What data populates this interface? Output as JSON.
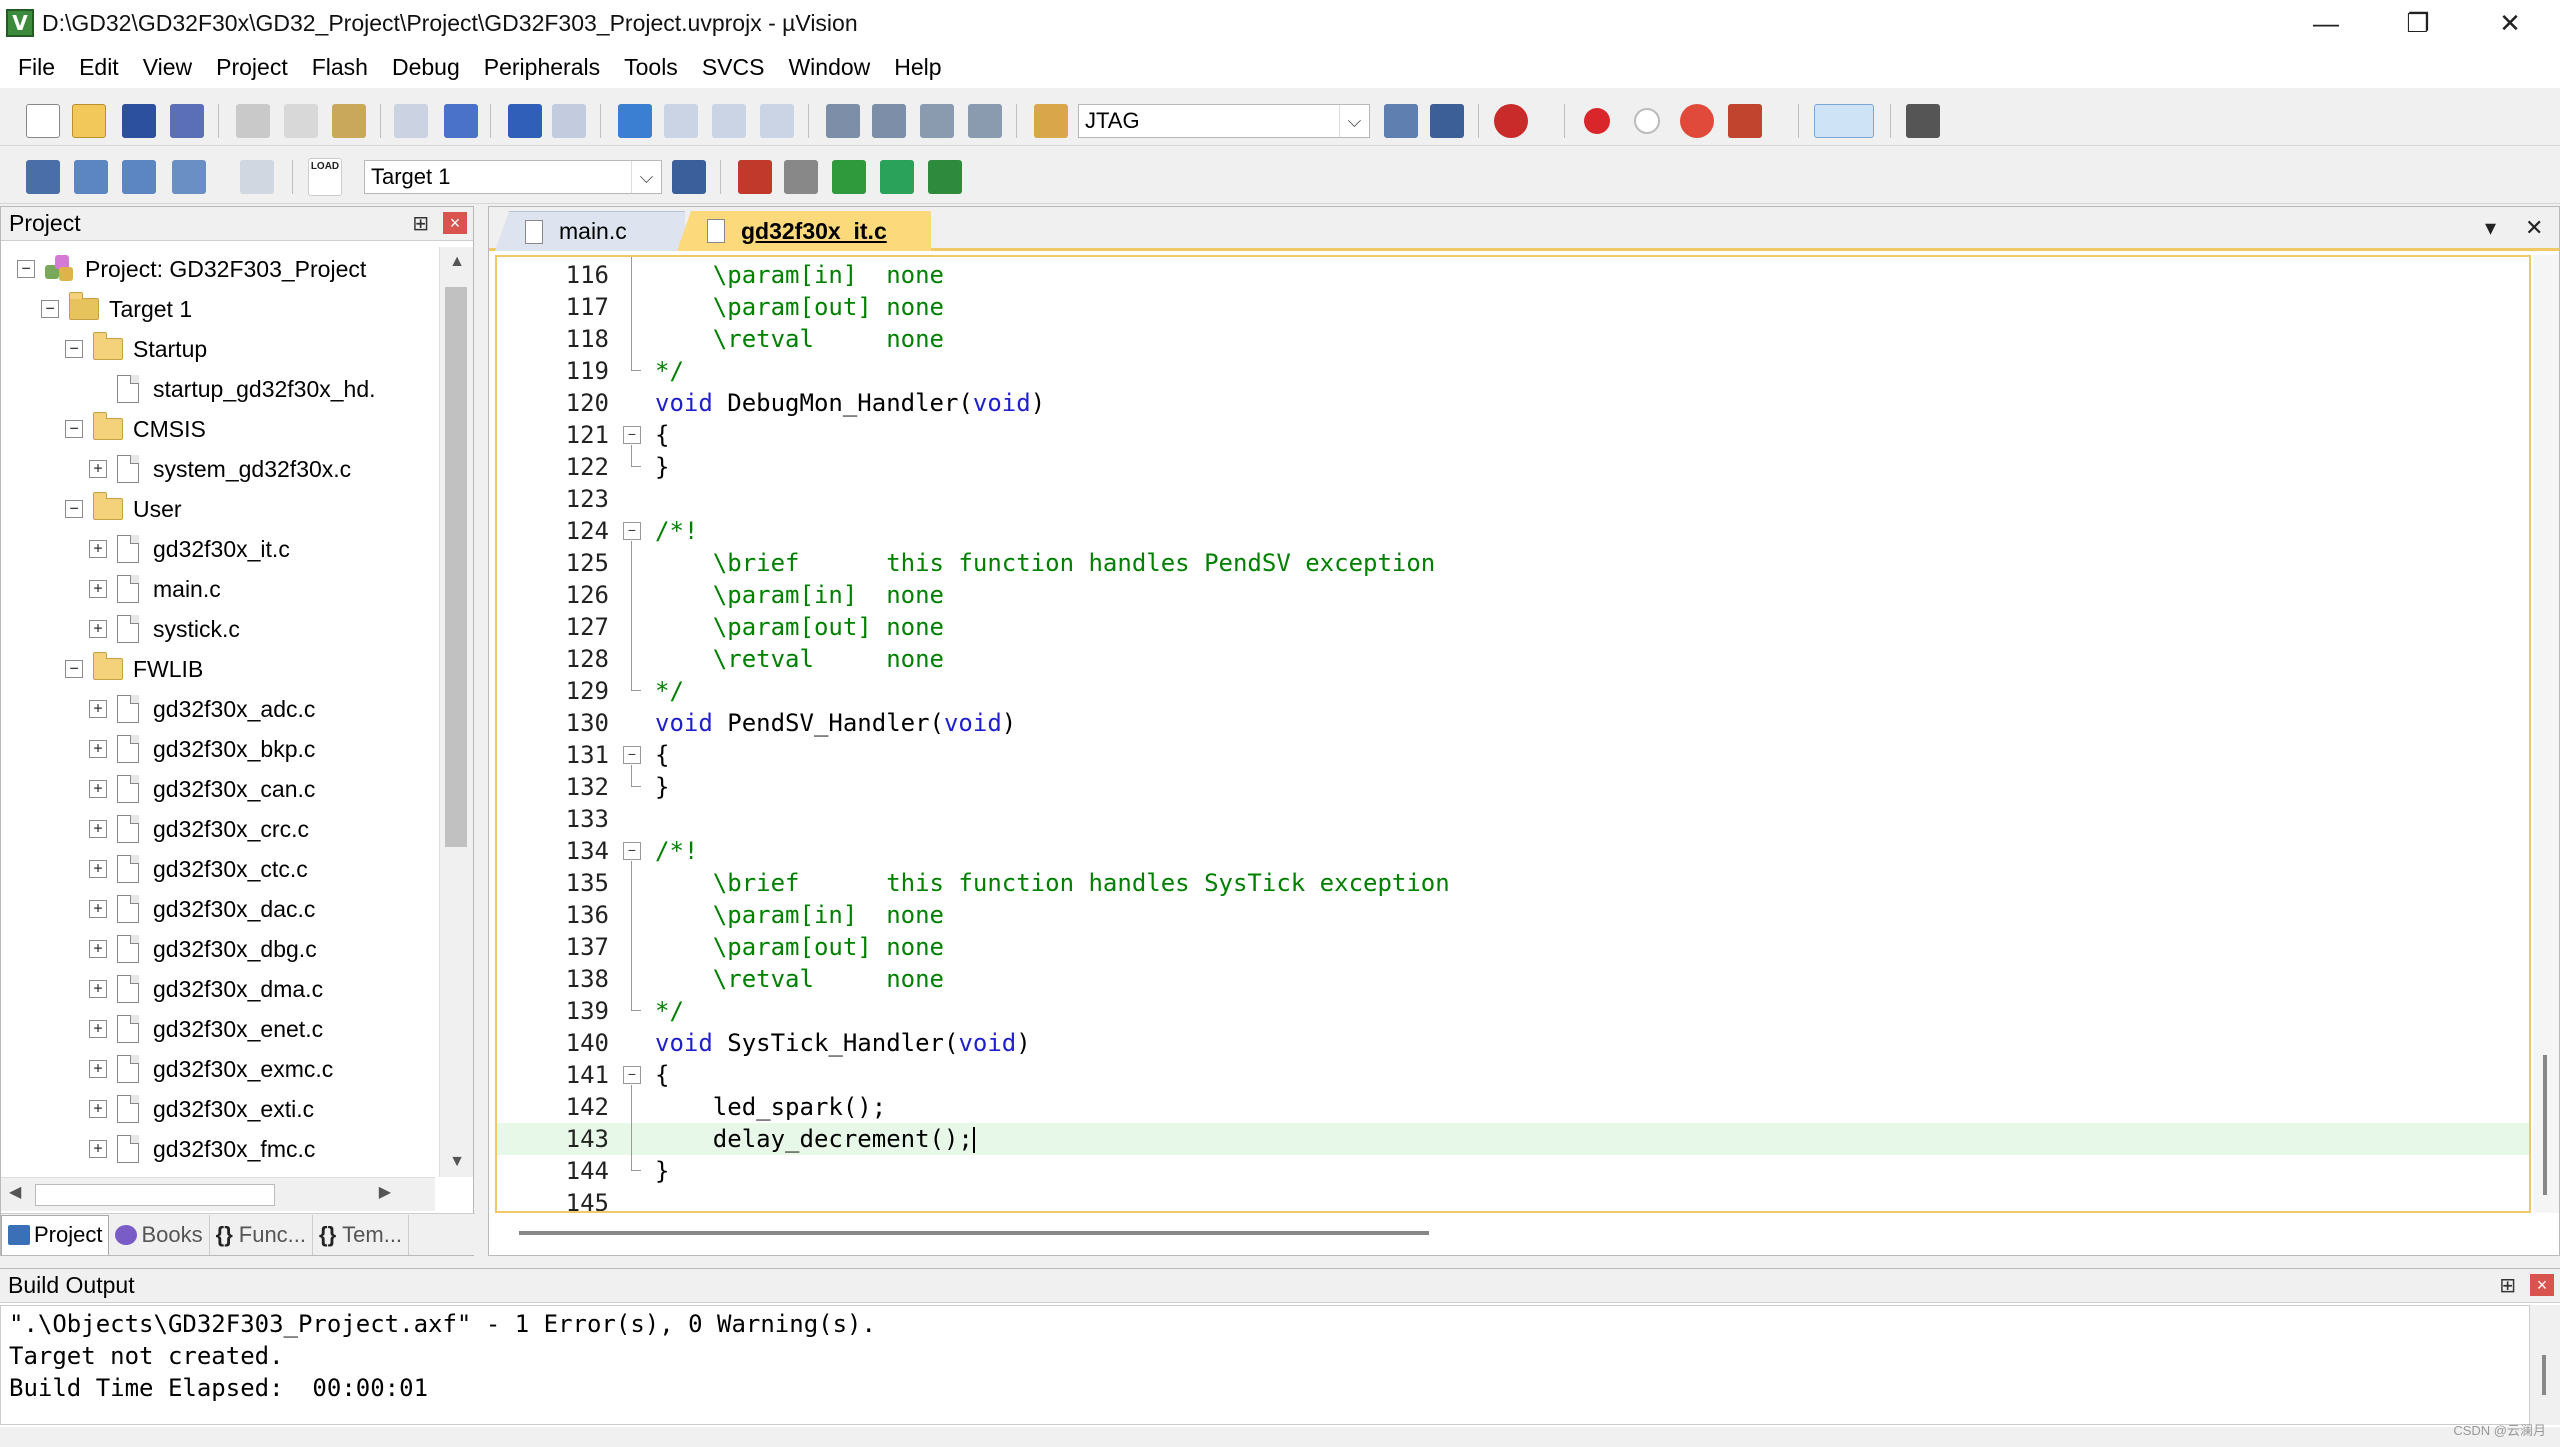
{
  "window": {
    "title": "D:\\GD32\\GD32F30x\\GD32_Project\\Project\\GD32F303_Project.uvprojx - µVision",
    "icon_letter": "V",
    "minimize": "—",
    "maximize": "❐",
    "close": "✕"
  },
  "menu": [
    "File",
    "Edit",
    "View",
    "Project",
    "Flash",
    "Debug",
    "Peripherals",
    "Tools",
    "SVCS",
    "Window",
    "Help"
  ],
  "toolbar": {
    "debug_adapter": "JTAG",
    "target": "Target 1",
    "load_label": "LOAD"
  },
  "project_panel": {
    "title": "Project",
    "pin": "⊞",
    "close": "×",
    "tree": [
      {
        "label": "Project: GD32F303_Project",
        "level": 0,
        "kind": "project",
        "expander": "−"
      },
      {
        "label": "Target 1",
        "level": 1,
        "kind": "target",
        "expander": "−"
      },
      {
        "label": "Startup",
        "level": 2,
        "kind": "folder",
        "expander": "−"
      },
      {
        "label": "startup_gd32f30x_hd.",
        "level": 3,
        "kind": "file",
        "expander": ""
      },
      {
        "label": "CMSIS",
        "level": 2,
        "kind": "folder",
        "expander": "−"
      },
      {
        "label": "system_gd32f30x.c",
        "level": 3,
        "kind": "file",
        "expander": "+"
      },
      {
        "label": "User",
        "level": 2,
        "kind": "folder",
        "expander": "−"
      },
      {
        "label": "gd32f30x_it.c",
        "level": 3,
        "kind": "file",
        "expander": "+"
      },
      {
        "label": "main.c",
        "level": 3,
        "kind": "file",
        "expander": "+"
      },
      {
        "label": "systick.c",
        "level": 3,
        "kind": "file",
        "expander": "+"
      },
      {
        "label": "FWLIB",
        "level": 2,
        "kind": "folder",
        "expander": "−"
      },
      {
        "label": "gd32f30x_adc.c",
        "level": 3,
        "kind": "file",
        "expander": "+"
      },
      {
        "label": "gd32f30x_bkp.c",
        "level": 3,
        "kind": "file",
        "expander": "+"
      },
      {
        "label": "gd32f30x_can.c",
        "level": 3,
        "kind": "file",
        "expander": "+"
      },
      {
        "label": "gd32f30x_crc.c",
        "level": 3,
        "kind": "file",
        "expander": "+"
      },
      {
        "label": "gd32f30x_ctc.c",
        "level": 3,
        "kind": "file",
        "expander": "+"
      },
      {
        "label": "gd32f30x_dac.c",
        "level": 3,
        "kind": "file",
        "expander": "+"
      },
      {
        "label": "gd32f30x_dbg.c",
        "level": 3,
        "kind": "file",
        "expander": "+"
      },
      {
        "label": "gd32f30x_dma.c",
        "level": 3,
        "kind": "file",
        "expander": "+"
      },
      {
        "label": "gd32f30x_enet.c",
        "level": 3,
        "kind": "file",
        "expander": "+"
      },
      {
        "label": "gd32f30x_exmc.c",
        "level": 3,
        "kind": "file",
        "expander": "+"
      },
      {
        "label": "gd32f30x_exti.c",
        "level": 3,
        "kind": "file",
        "expander": "+"
      },
      {
        "label": "gd32f30x_fmc.c",
        "level": 3,
        "kind": "file",
        "expander": "+"
      }
    ],
    "tabs": [
      {
        "label": "Project",
        "color": "#3b6fb6"
      },
      {
        "label": "Books",
        "color": "#7a5cc7"
      },
      {
        "label": "Func...",
        "color": "#444444"
      },
      {
        "label": "Tem...",
        "color": "#444444"
      }
    ],
    "tab_glyphs": [
      "",
      "",
      "{}",
      "{}"
    ]
  },
  "editor": {
    "tabs": [
      {
        "label": "main.c",
        "active": false
      },
      {
        "label": "gd32f30x_it.c",
        "active": true
      }
    ],
    "tab_menu": "▾",
    "tab_close": "✕",
    "lines": [
      {
        "n": "116",
        "segs": [
          {
            "t": "    \\param[in]  none",
            "c": "com"
          }
        ]
      },
      {
        "n": "117",
        "segs": [
          {
            "t": "    \\param[out] none",
            "c": "com"
          }
        ]
      },
      {
        "n": "118",
        "segs": [
          {
            "t": "    \\retval     none",
            "c": "com"
          }
        ]
      },
      {
        "n": "119",
        "segs": [
          {
            "t": "*/",
            "c": "com"
          }
        ]
      },
      {
        "n": "120",
        "segs": [
          {
            "t": "void",
            "c": "kw"
          },
          {
            "t": " DebugMon_Handler(",
            "c": "pl"
          },
          {
            "t": "void",
            "c": "kw"
          },
          {
            "t": ")",
            "c": "pl"
          }
        ]
      },
      {
        "n": "121",
        "segs": [
          {
            "t": "{",
            "c": "pl"
          }
        ]
      },
      {
        "n": "122",
        "segs": [
          {
            "t": "}",
            "c": "pl"
          }
        ]
      },
      {
        "n": "123",
        "segs": [
          {
            "t": "",
            "c": "pl"
          }
        ]
      },
      {
        "n": "124",
        "segs": [
          {
            "t": "/*!",
            "c": "com"
          }
        ]
      },
      {
        "n": "125",
        "segs": [
          {
            "t": "    \\brief      this function handles PendSV exception",
            "c": "com"
          }
        ]
      },
      {
        "n": "126",
        "segs": [
          {
            "t": "    \\param[in]  none",
            "c": "com"
          }
        ]
      },
      {
        "n": "127",
        "segs": [
          {
            "t": "    \\param[out] none",
            "c": "com"
          }
        ]
      },
      {
        "n": "128",
        "segs": [
          {
            "t": "    \\retval     none",
            "c": "com"
          }
        ]
      },
      {
        "n": "129",
        "segs": [
          {
            "t": "*/",
            "c": "com"
          }
        ]
      },
      {
        "n": "130",
        "segs": [
          {
            "t": "void",
            "c": "kw"
          },
          {
            "t": " PendSV_Handler(",
            "c": "pl"
          },
          {
            "t": "void",
            "c": "kw"
          },
          {
            "t": ")",
            "c": "pl"
          }
        ]
      },
      {
        "n": "131",
        "segs": [
          {
            "t": "{",
            "c": "pl"
          }
        ]
      },
      {
        "n": "132",
        "segs": [
          {
            "t": "}",
            "c": "pl"
          }
        ]
      },
      {
        "n": "133",
        "segs": [
          {
            "t": "",
            "c": "pl"
          }
        ]
      },
      {
        "n": "134",
        "segs": [
          {
            "t": "/*!",
            "c": "com"
          }
        ]
      },
      {
        "n": "135",
        "segs": [
          {
            "t": "    \\brief      this function handles SysTick exception",
            "c": "com"
          }
        ]
      },
      {
        "n": "136",
        "segs": [
          {
            "t": "    \\param[in]  none",
            "c": "com"
          }
        ]
      },
      {
        "n": "137",
        "segs": [
          {
            "t": "    \\param[out] none",
            "c": "com"
          }
        ]
      },
      {
        "n": "138",
        "segs": [
          {
            "t": "    \\retval     none",
            "c": "com"
          }
        ]
      },
      {
        "n": "139",
        "segs": [
          {
            "t": "*/",
            "c": "com"
          }
        ]
      },
      {
        "n": "140",
        "segs": [
          {
            "t": "void",
            "c": "kw"
          },
          {
            "t": " SysTick_Handler(",
            "c": "pl"
          },
          {
            "t": "void",
            "c": "kw"
          },
          {
            "t": ")",
            "c": "pl"
          }
        ]
      },
      {
        "n": "141",
        "segs": [
          {
            "t": "{",
            "c": "pl"
          }
        ]
      },
      {
        "n": "142",
        "segs": [
          {
            "t": "    led_spark();",
            "c": "pl"
          }
        ]
      },
      {
        "n": "143",
        "segs": [
          {
            "t": "    delay_decrement();",
            "c": "pl"
          }
        ],
        "current": true
      },
      {
        "n": "144",
        "segs": [
          {
            "t": "}",
            "c": "pl"
          }
        ]
      },
      {
        "n": "145",
        "segs": [
          {
            "t": "",
            "c": "pl"
          }
        ]
      }
    ]
  },
  "build_output": {
    "title": "Build Output",
    "pin": "⊞",
    "close": "×",
    "lines": [
      "\".\\Objects\\GD32F303_Project.axf\" - 1 Error(s), 0 Warning(s).",
      "Target not created.",
      "Build Time Elapsed:  00:00:01"
    ]
  },
  "watermark": "CSDN @云澜月",
  "colors": {
    "comment": "#008000",
    "keyword": "#1f1fcc",
    "active_tab": "#fcd97b",
    "current_line": "#e8f8e8"
  }
}
